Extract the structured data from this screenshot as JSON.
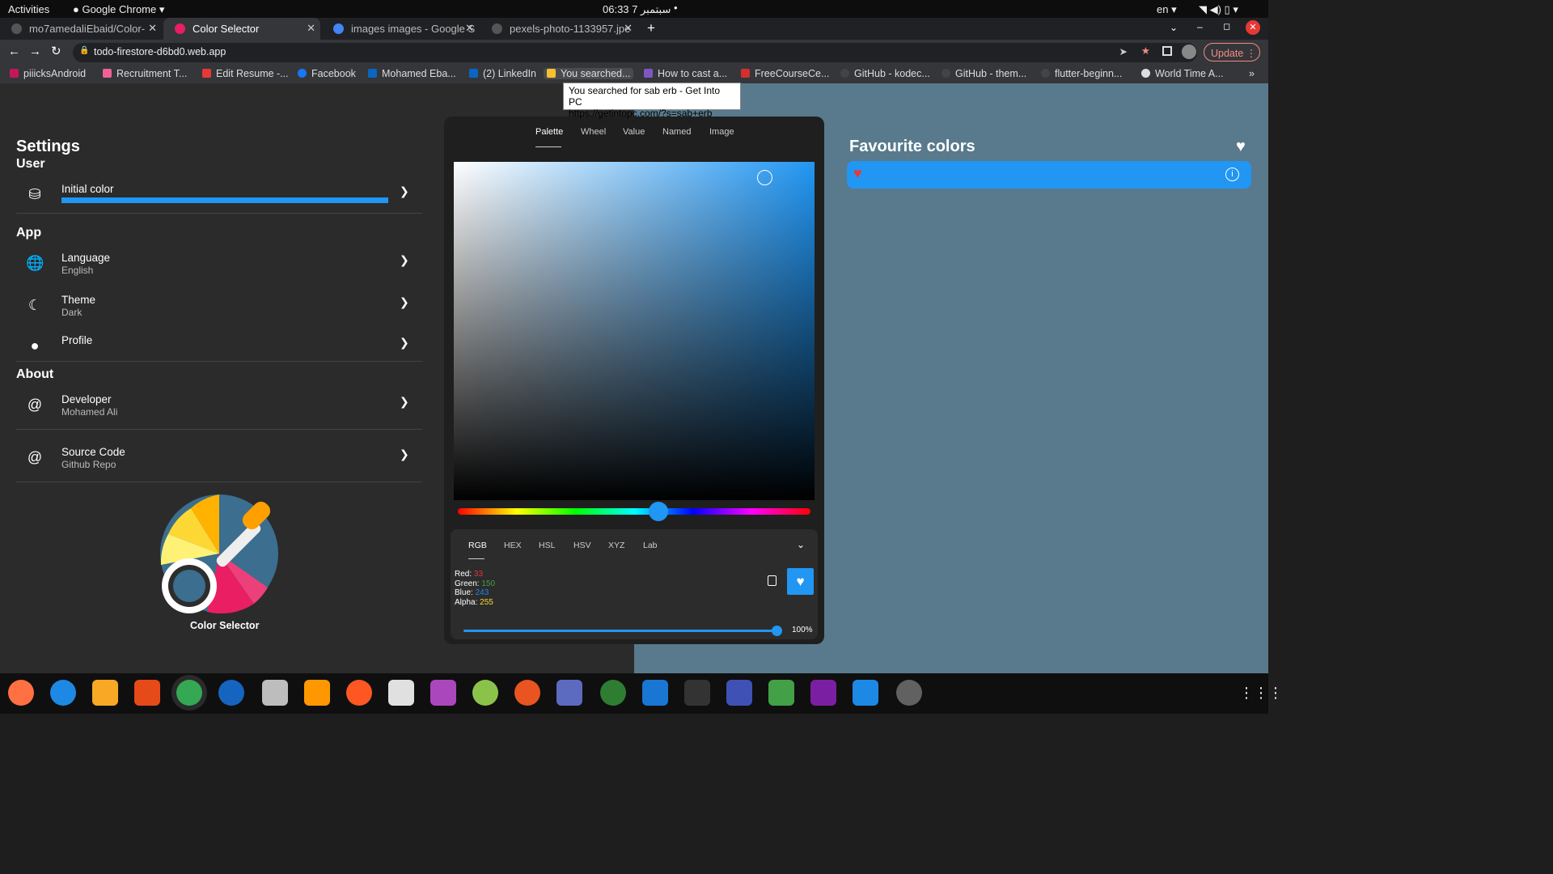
{
  "os": {
    "activities": "Activities",
    "app": "Google Chrome",
    "time": "06:33  7 سبتمبر",
    "lang": "en"
  },
  "tabs": [
    {
      "title": "mo7amedaliEbaid/Color-"
    },
    {
      "title": "Color Selector"
    },
    {
      "title": "images images - Google S"
    },
    {
      "title": "pexels-photo-1133957.jpe"
    }
  ],
  "omnibox": {
    "url": "todo-firestore-d6bd0.web.app",
    "update": "Update"
  },
  "bookmarks": [
    "piiicksAndroid",
    "Recruitment T...",
    "Edit Resume -...",
    "Facebook",
    "Mohamed Eba...",
    "(2) LinkedIn",
    "You searched...",
    "How to cast a...",
    "FreeCourseCe...",
    "GitHub - kodec...",
    "GitHub - them...",
    "flutter-beginn...",
    "World Time A..."
  ],
  "tooltip": {
    "line1": "You searched for sab erb - Get Into PC",
    "line2": "https://getintopc.com/?s=sab+erb"
  },
  "settings": {
    "title": "Settings",
    "user": "User",
    "initial_color": "Initial color",
    "app": "App",
    "language": "Language",
    "language_val": "English",
    "theme": "Theme",
    "theme_val": "Dark",
    "profile": "Profile",
    "about": "About",
    "developer": "Developer",
    "developer_val": "Mohamed Ali",
    "source": "Source Code",
    "source_val": "Github Repo",
    "logo_label": "Color Selector"
  },
  "picker": {
    "tabs": [
      "Palette",
      "Wheel",
      "Value",
      "Named",
      "Image"
    ],
    "formats": [
      "RGB",
      "HEX",
      "HSL",
      "HSV",
      "XYZ",
      "Lab"
    ],
    "red_label": "Red:",
    "red": "33",
    "green_label": "Green:",
    "green": "150",
    "blue_label": "Blue:",
    "blue": "243",
    "alpha_label": "Alpha:",
    "alpha": "255",
    "opacity": "100%",
    "color": "#2196f3"
  },
  "favourites": {
    "title": "Favourite colors"
  }
}
